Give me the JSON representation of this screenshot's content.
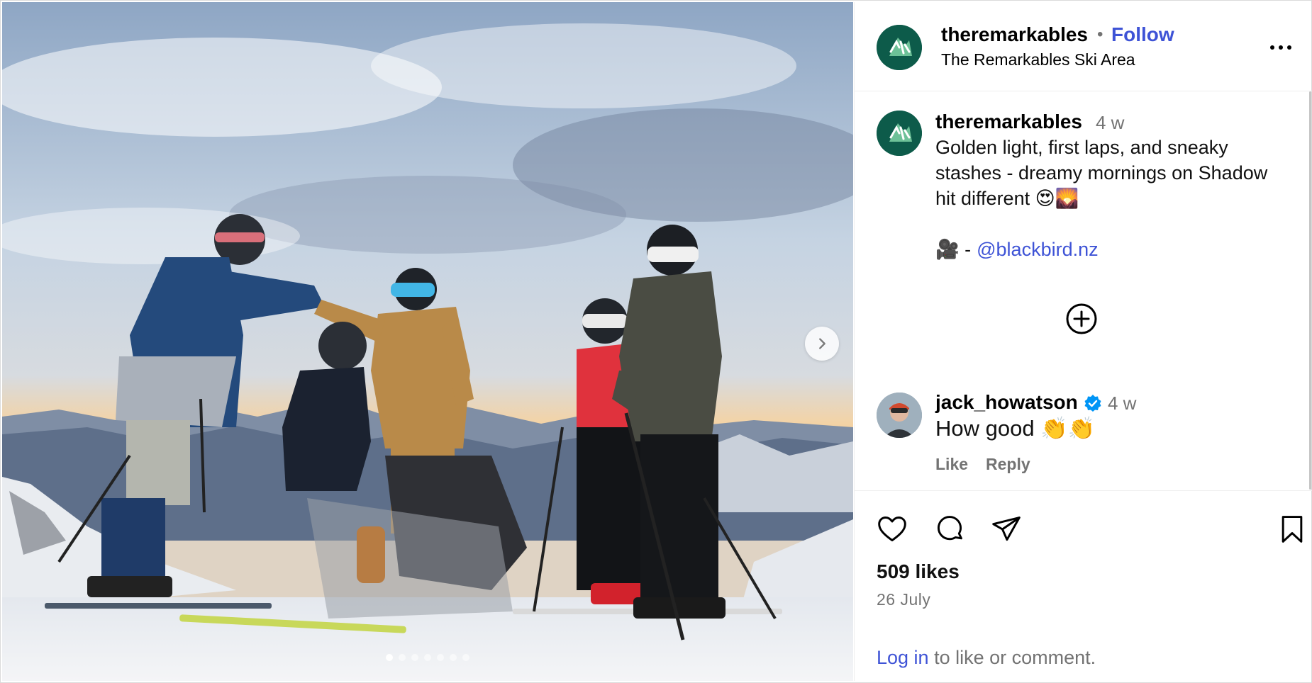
{
  "account": {
    "username": "theremarkables",
    "subtitle": "The Remarkables Ski Area",
    "follow_label": "Follow",
    "separator": "•"
  },
  "caption": {
    "username": "theremarkables",
    "time": "4 w",
    "text": "Golden light, first laps, and sneaky stashes - dreamy mornings on Shadow hit different 😍🌄",
    "credit_prefix": "🎥 -",
    "credit_handle": "@blackbird.nz"
  },
  "comment": {
    "username": "jack_howatson",
    "time": "4 w",
    "text": "How good 👏👏",
    "like_label": "Like",
    "reply_label": "Reply"
  },
  "post": {
    "likes": "509 likes",
    "date": "26 July",
    "login_link": "Log in",
    "login_rest": " to like or comment."
  },
  "carousel": {
    "total_slides": 7,
    "active_index": 0
  },
  "icons": {
    "more": "more-options-icon",
    "next": "chevron-right-icon",
    "load_more": "plus-circle-icon",
    "verified": "verified-badge-icon",
    "like": "heart-icon",
    "comment": "comment-bubble-icon",
    "share": "paper-plane-icon",
    "save": "bookmark-icon"
  },
  "colors": {
    "link": "#3e53d6",
    "secondary_text": "#737373",
    "brand_green": "#0d5b4a",
    "verified_blue": "#0095f6"
  }
}
